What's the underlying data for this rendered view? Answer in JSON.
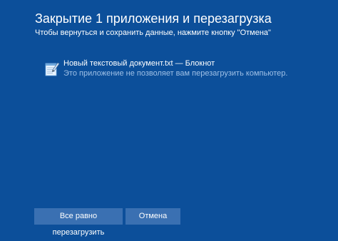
{
  "screen": {
    "title": "Закрытие 1 приложения и перезагрузка",
    "subtitle": "Чтобы вернуться и сохранить данные, нажмите кнопку \"Отмена\"",
    "background_color": "#0c4f9a"
  },
  "apps": [
    {
      "icon": "notepad-icon",
      "name": "Новый текстовый документ.txt — Блокнот",
      "status": "Это приложение не позволяет вам перезагрузить компьютер."
    }
  ],
  "buttons": {
    "force_restart_label": "Все равно перезагрузить",
    "cancel_label": "Отмена",
    "button_color": "#3a70b2"
  }
}
